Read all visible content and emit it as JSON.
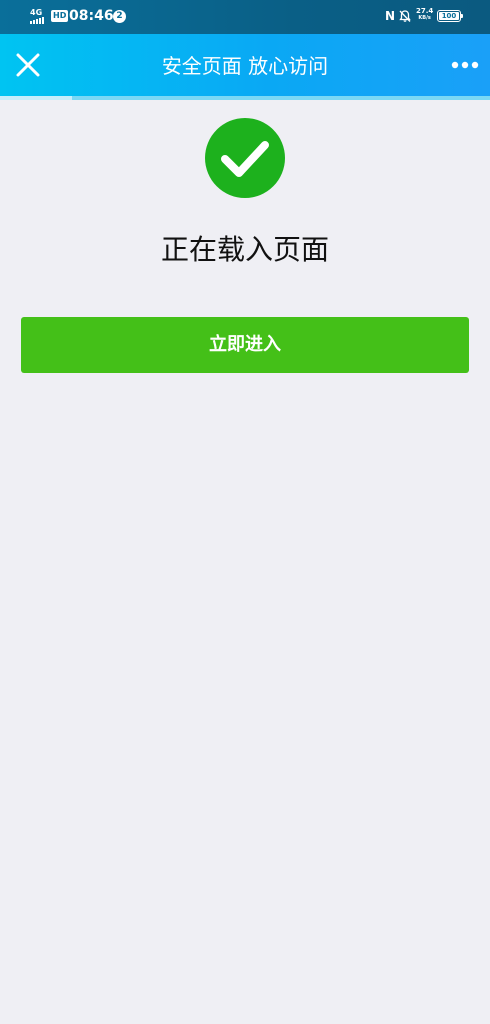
{
  "status_bar": {
    "network": "4G",
    "hd": "HD",
    "time": "08:46",
    "notification_count": "2",
    "nfc": "N",
    "net_speed_value": "27.4",
    "net_speed_unit": "KB/s",
    "battery": "100"
  },
  "nav": {
    "close_icon": "close-icon",
    "title": "安全页面 放心访问",
    "more_icon": "more-dots-icon",
    "load_progress": 0.146
  },
  "content": {
    "status_icon": "check-circle-icon",
    "status_icon_color": "#1db11d",
    "loading_text": "正在载入页面",
    "enter_button_label": "立即进入",
    "enter_button_color": "#44c018"
  }
}
